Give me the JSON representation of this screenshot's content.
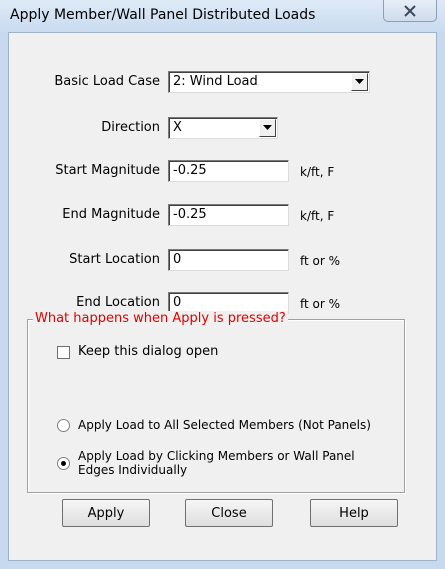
{
  "window": {
    "title": "Apply Member/Wall Panel Distributed Loads"
  },
  "form": {
    "basic_load_case": {
      "label": "Basic Load Case",
      "value": "2: Wind Load"
    },
    "direction": {
      "label": "Direction",
      "value": "X"
    },
    "start_magnitude": {
      "label": "Start Magnitude",
      "value": "-0.25",
      "unit": "k/ft, F"
    },
    "end_magnitude": {
      "label": "End Magnitude",
      "value": "-0.25",
      "unit": "k/ft, F"
    },
    "start_location": {
      "label": "Start Location",
      "value": "0",
      "unit": "ft or %"
    },
    "end_location": {
      "label": "End Location",
      "value": "0",
      "unit": "ft or %"
    }
  },
  "apply_group": {
    "title": "What happens when Apply is pressed?",
    "keep_open_label": "Keep this dialog open",
    "keep_open_checked": false,
    "radio_all_label": "Apply Load to All Selected Members (Not Panels)",
    "radio_click_label_line1": "Apply Load by Clicking Members or Wall Panel",
    "radio_click_label_line2": "Edges Individually",
    "selected": "click"
  },
  "buttons": {
    "apply": "Apply",
    "close": "Close",
    "help": "Help"
  },
  "colors": {
    "group_title": "#e00000",
    "titlebar": "#c9dbef"
  }
}
